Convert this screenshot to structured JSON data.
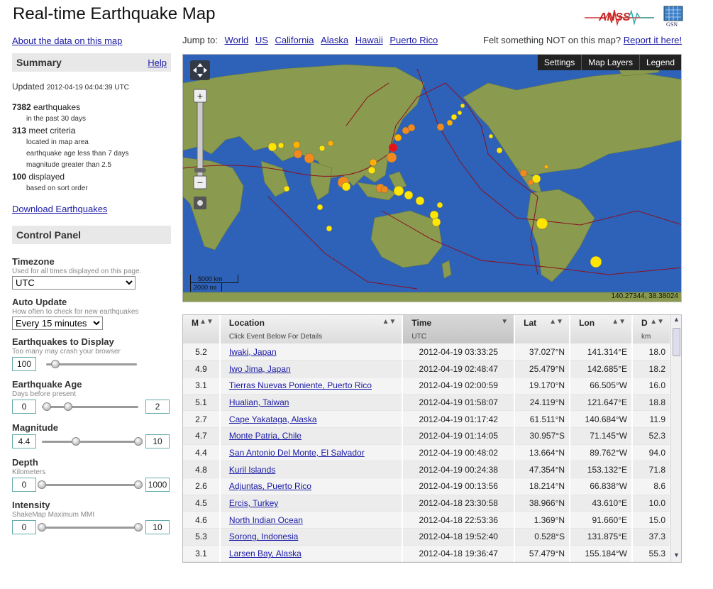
{
  "header": {
    "title": "Real-time Earthquake Map",
    "anss_logo": "ANSS",
    "gsn_logo": "GSN"
  },
  "left": {
    "about_link": "About the data on this map",
    "summary_title": "Summary",
    "help_link": "Help",
    "updated_label": "Updated",
    "updated_time": "2012-04-19 04:04:39 UTC",
    "stats": [
      {
        "num": "7382",
        "label": "earthquakes",
        "subs": [
          "in the past 30 days"
        ]
      },
      {
        "num": "313",
        "label": "meet criteria",
        "subs": [
          "located in map area",
          "earthquake age less than 7 days",
          "magnitude greater than 2.5"
        ]
      },
      {
        "num": "100",
        "label": "displayed",
        "subs": [
          "based on sort order"
        ]
      }
    ],
    "download_link": "Download Earthquakes",
    "control_panel_title": "Control Panel",
    "timezone": {
      "label": "Timezone",
      "desc": "Used for all times displayed on this page.",
      "value": "UTC"
    },
    "auto_update": {
      "label": "Auto Update",
      "desc": "How often to check for new earthquakes",
      "value": "Every 15 minutes"
    },
    "to_display": {
      "label": "Earthquakes to Display",
      "desc": "Too many may crash your browser",
      "value": "100",
      "level": 0.1
    },
    "age": {
      "label": "Earthquake Age",
      "desc": "Days before present",
      "min": "0",
      "max": "2",
      "low": 0.05,
      "high": 0.27
    },
    "magnitude": {
      "label": "Magnitude",
      "desc": "",
      "min": "4.4",
      "max": "10",
      "low": 0.35,
      "high": 1.0
    },
    "depth": {
      "label": "Depth",
      "desc": "Kilometers",
      "min": "0",
      "max": "1000",
      "low": 0.0,
      "high": 1.0
    },
    "intensity": {
      "label": "Intensity",
      "desc": "ShakeMap Maximum MMI",
      "min": "0",
      "max": "10",
      "low": 0.0,
      "high": 1.0
    }
  },
  "jump": {
    "label": "Jump to:",
    "links": [
      "World",
      "US",
      "California",
      "Alaska",
      "Hawaii",
      "Puerto Rico"
    ],
    "felt_text": "Felt something NOT on this map?",
    "report_link": "Report it here!"
  },
  "map": {
    "toolbar": [
      "Settings",
      "Map Layers",
      "Legend"
    ],
    "coords": "140.27344, 38.38024",
    "scale_km": "5000 km",
    "scale_mi": "2000 mi",
    "ocean_color": "#2e62b8",
    "land_color": "#8a9a4e"
  },
  "table": {
    "headers": [
      {
        "label": "M",
        "sub": ""
      },
      {
        "label": "Location",
        "sub": "Click Event Below For Details"
      },
      {
        "label": "Time",
        "sub": "UTC"
      },
      {
        "label": "Lat",
        "sub": ""
      },
      {
        "label": "Lon",
        "sub": ""
      },
      {
        "label": "D",
        "sub": "km"
      }
    ],
    "rows": [
      [
        "5.2",
        "Iwaki, Japan",
        "2012-04-19 03:33:25",
        "37.027°N",
        "141.314°E",
        "18.0"
      ],
      [
        "4.9",
        "Iwo Jima, Japan",
        "2012-04-19 02:48:47",
        "25.479°N",
        "142.685°E",
        "18.2"
      ],
      [
        "3.1",
        "Tierras Nuevas Poniente, Puerto Rico",
        "2012-04-19 02:00:59",
        "19.170°N",
        "66.505°W",
        "16.0"
      ],
      [
        "5.1",
        "Hualian, Taiwan",
        "2012-04-19 01:58:07",
        "24.119°N",
        "121.647°E",
        "18.8"
      ],
      [
        "2.7",
        "Cape Yakataga, Alaska",
        "2012-04-19 01:17:42",
        "61.511°N",
        "140.684°W",
        "11.9"
      ],
      [
        "4.7",
        "Monte Patria, Chile",
        "2012-04-19 01:14:05",
        "30.957°S",
        "71.145°W",
        "52.3"
      ],
      [
        "4.4",
        "San Antonio Del Monte, El Salvador",
        "2012-04-19 00:48:02",
        "13.664°N",
        "89.762°W",
        "94.0"
      ],
      [
        "4.8",
        "Kuril Islands",
        "2012-04-19 00:24:38",
        "47.354°N",
        "153.132°E",
        "71.8"
      ],
      [
        "2.6",
        "Adjuntas, Puerto Rico",
        "2012-04-19 00:13:56",
        "18.214°N",
        "66.838°W",
        "8.6"
      ],
      [
        "4.5",
        "Ercis, Turkey",
        "2012-04-18 23:30:58",
        "38.966°N",
        "43.610°E",
        "10.0"
      ],
      [
        "4.6",
        "North Indian Ocean",
        "2012-04-18 22:53:36",
        "1.369°N",
        "91.660°E",
        "15.0"
      ],
      [
        "5.3",
        "Sorong, Indonesia",
        "2012-04-18 19:52:40",
        "0.528°S",
        "131.875°E",
        "37.3"
      ],
      [
        "3.1",
        "Larsen Bay, Alaska",
        "2012-04-18 19:36:47",
        "57.479°N",
        "155.184°W",
        "55.3"
      ]
    ]
  }
}
